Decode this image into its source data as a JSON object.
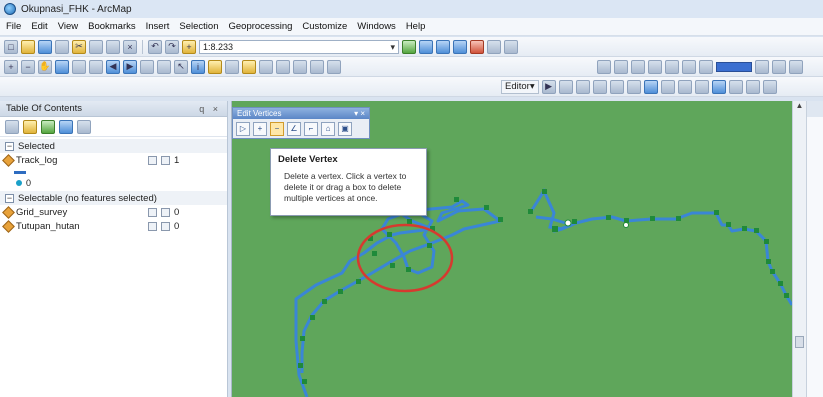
{
  "window": {
    "title": "Okupnasi_FHK - ArcMap"
  },
  "menu": [
    "File",
    "Edit",
    "View",
    "Bookmarks",
    "Insert",
    "Selection",
    "Geoprocessing",
    "Customize",
    "Windows",
    "Help"
  ],
  "toolbar": {
    "scale_value": "1:8.233",
    "editor_label": "Editor▾"
  },
  "toc": {
    "title": "Table Of Contents",
    "pin_close": "q ×",
    "groups": [
      {
        "label": "Selected",
        "layers": [
          {
            "name": "Track_log",
            "count": "1"
          }
        ],
        "legend_value": "0"
      },
      {
        "label": "Selectable (no features selected)",
        "layers": [
          {
            "name": "Grid_survey",
            "count": "0"
          },
          {
            "name": "Tutupan_hutan",
            "count": "0"
          }
        ]
      }
    ]
  },
  "edit_vertices": {
    "title": "Edit Vertices",
    "controls": "▾ ×"
  },
  "tooltip": {
    "title": "Delete Vertex",
    "body": "Delete a vertex. Click a vertex to delete it or drag a box to delete multiple vertices at once."
  },
  "colors": {
    "map_bg": "#5fa65b",
    "track_line": "#3a86d6",
    "vertex": "#1f8a3a",
    "highlight_circle": "#d63a2f"
  }
}
